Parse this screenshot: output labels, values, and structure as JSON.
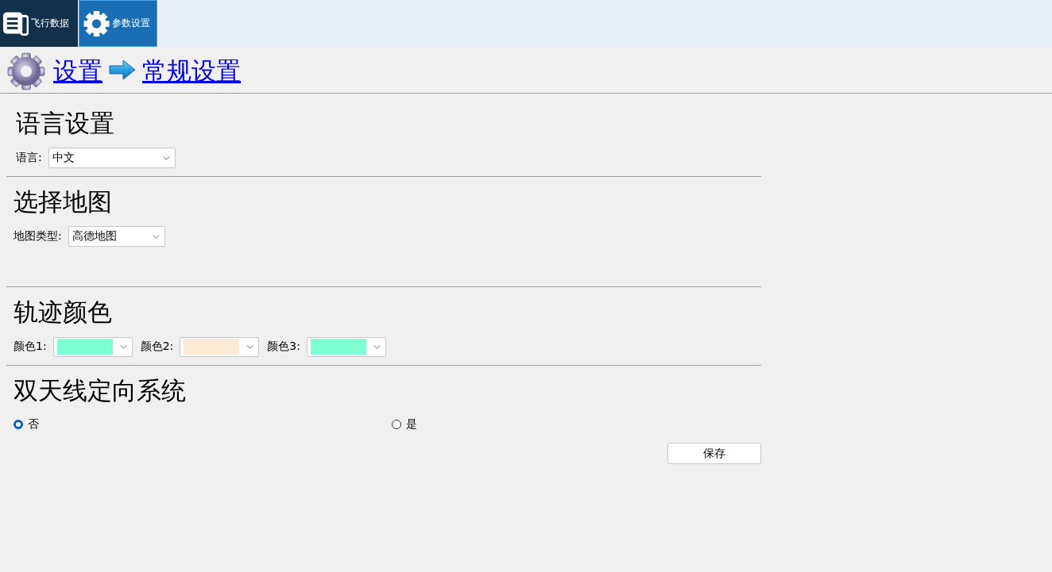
{
  "nav_tabs": [
    {
      "label": "飞行数据",
      "selected": false
    },
    {
      "label": "参数设置",
      "selected": true
    }
  ],
  "breadcrumb": [
    "设置",
    "常规设置"
  ],
  "sections": [
    {
      "title": "语言设置",
      "kind": "selects",
      "fields": [
        {
          "label": "语言:",
          "value": "中文"
        }
      ]
    },
    {
      "title": "选择地图",
      "kind": "selects",
      "fields": [
        {
          "label": "地图类型:",
          "value": "高德地图"
        }
      ]
    },
    {
      "title": "轨迹颜色",
      "kind": "colors",
      "fields": [
        {
          "label": "颜色1:",
          "color": "#7fffd4"
        },
        {
          "label": "颜色2:",
          "color": "#faebd7"
        },
        {
          "label": "颜色3:",
          "color": "#7fffd4"
        }
      ]
    },
    {
      "title": "双天线定向系统",
      "kind": "radios",
      "options": [
        {
          "label": "否",
          "selected": true
        },
        {
          "label": "是",
          "selected": false
        }
      ]
    }
  ],
  "save_button": "保存"
}
